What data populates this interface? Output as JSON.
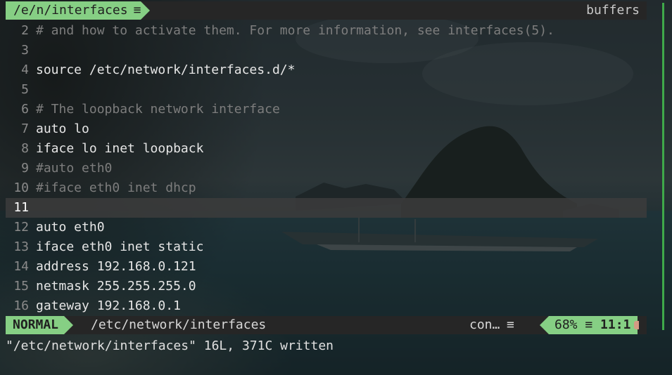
{
  "window": {
    "tab_title": "/e/n/interfaces",
    "tab_icon": "≡",
    "buffers_label": "buffers"
  },
  "editor": {
    "lines": [
      {
        "num": "2",
        "text": "# and how to activate them. For more information, see interfaces(5).",
        "type": "comment"
      },
      {
        "num": "3",
        "text": "",
        "type": "code"
      },
      {
        "num": "4",
        "text": "source /etc/network/interfaces.d/*",
        "type": "code"
      },
      {
        "num": "5",
        "text": "",
        "type": "code"
      },
      {
        "num": "6",
        "text": "# The loopback network interface",
        "type": "comment"
      },
      {
        "num": "7",
        "text": "auto lo",
        "type": "code"
      },
      {
        "num": "8",
        "text": "iface lo inet loopback",
        "type": "code"
      },
      {
        "num": "9",
        "text": "#auto eth0",
        "type": "comment"
      },
      {
        "num": "10",
        "text": "#iface eth0 inet dhcp",
        "type": "comment"
      },
      {
        "num": "11",
        "text": "",
        "type": "current"
      },
      {
        "num": "12",
        "text": "auto eth0",
        "type": "code"
      },
      {
        "num": "13",
        "text": "iface eth0 inet static",
        "type": "code"
      },
      {
        "num": "14",
        "text": "address 192.168.0.121",
        "type": "code"
      },
      {
        "num": "15",
        "text": "netmask 255.255.255.0",
        "type": "code"
      },
      {
        "num": "16",
        "text": "gateway 192.168.0.1",
        "type": "code"
      }
    ]
  },
  "statusline": {
    "mode": "NORMAL",
    "file": "/etc/network/interfaces",
    "encoding": "con…",
    "encoding_icon": "≡",
    "percent": "68%",
    "percent_icon": "≡",
    "position": "11:1"
  },
  "cmdline": {
    "message": "\"/etc/network/interfaces\" 16L, 371C written"
  },
  "colors": {
    "accent": "#86cf84",
    "bar_bg": "#262626",
    "scrollbar": "#3fa94a"
  }
}
